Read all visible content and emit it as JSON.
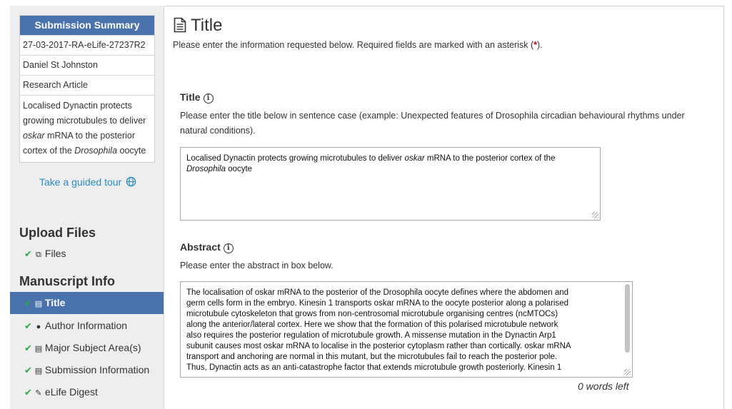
{
  "summary": {
    "header": "Submission Summary",
    "manuscript_id": "27-03-2017-RA-eLife-27237R2",
    "author": "Daniel St Johnston",
    "article_type": "Research Article",
    "title_line1": "Localised Dynactin protects",
    "title_line2": "growing microtubules to deliver",
    "title_line3_italic": "oskar",
    "title_line3_rest": " mRNA to the posterior",
    "title_line4_start": "cortex of the ",
    "title_line4_italic": "Drosophila",
    "title_line4_end": " oocyte"
  },
  "tour": {
    "label": "Take a guided tour",
    "icon": "globe-icon"
  },
  "sidebar": {
    "upload_heading": "Upload Files",
    "manuscript_heading": "Manuscript Info",
    "items": [
      {
        "label": "Files",
        "icon": "files-icon"
      },
      {
        "label": "Title",
        "icon": "document-icon"
      },
      {
        "label": "Author Information",
        "icon": "person-icon"
      },
      {
        "label": "Major Subject Area(s)",
        "icon": "document-icon"
      },
      {
        "label": "Submission Information",
        "icon": "document-icon"
      },
      {
        "label": "eLife Digest",
        "icon": "pencil-icon"
      }
    ],
    "check_glyph": "✔"
  },
  "page": {
    "title": "Title",
    "intro_before": "Please enter the information requested below. Required fields are marked with an asterisk (",
    "asterisk": "*",
    "intro_after": ")."
  },
  "title_field": {
    "label": "Title",
    "help": "Please enter the title below in sentence case (example: Unexpected features of Drosophila circadian behavioural rhythms under natural conditions).",
    "value_part1": "Localised Dynactin protects growing microtubules to deliver ",
    "value_italic1": "oskar",
    "value_part2": " mRNA to the posterior cortex of the ",
    "value_italic2": "Drosophila",
    "value_part3": " oocyte"
  },
  "abstract_field": {
    "label": "Abstract",
    "help": "Please enter the abstract in box below.",
    "lines": [
      "The localisation of oskar mRNA to the posterior of the Drosophila oocyte defines where the abdomen and",
      "germ cells form in the embryo. Kinesin 1 transports oskar mRNA to the oocyte posterior along a polarised",
      "microtubule cytoskeleton that grows from non-centrosomal microtubule organising centres (ncMTOCs)",
      "along the anterior/lateral cortex. Here we show that the formation of this polarised microtubule network",
      "also requires the posterior regulation of microtubule growth. A missense mutation in the Dynactin Arp1",
      "subunit causes most oskar mRNA to localise in the posterior cytoplasm rather than cortically. oskar mRNA",
      "transport and anchoring are normal in this mutant, but the microtubules fail to reach the posterior pole.",
      "Thus, Dynactin acts as an anti-catastrophe factor that extends microtubule growth posteriorly. Kinesin 1"
    ],
    "words_left": "0 words left"
  },
  "colors": {
    "accent": "#4a72ad",
    "link": "#2a8ac3",
    "check": "#2fa84f",
    "required": "#d0021b"
  }
}
